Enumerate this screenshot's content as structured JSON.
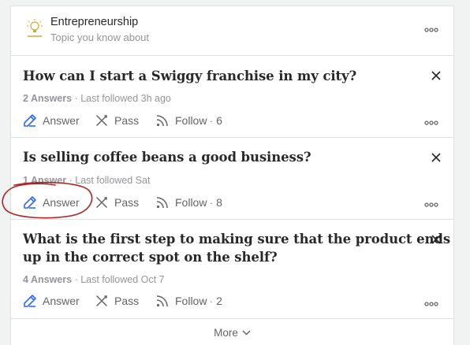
{
  "topic": {
    "title": "Entrepreneurship",
    "subtitle": "Topic you know about",
    "logo_icon": "lightbulb-logo"
  },
  "questions": [
    {
      "title": "How can I start a Swiggy franchise in my city?",
      "answers": "2 Answers",
      "last_followed": "Last followed 3h ago",
      "answer_label": "Answer",
      "pass_label": "Pass",
      "follow_label": "Follow",
      "follow_count": "6"
    },
    {
      "title": "Is selling coffee beans a good business?",
      "answers": "1 Answer",
      "last_followed": "Last followed Sat",
      "answer_label": "Answer",
      "pass_label": "Pass",
      "follow_label": "Follow",
      "follow_count": "8"
    },
    {
      "title_line1": "What is the first step to making sure that the product ends",
      "title_line2": "up in the correct spot on the shelf?",
      "answers": "4 Answers",
      "last_followed": "Last followed Oct 7",
      "answer_label": "Answer",
      "pass_label": "Pass",
      "follow_label": "Follow",
      "follow_count": "2"
    }
  ],
  "more_label": "More",
  "colors": {
    "answer_icon": "#2e69ff",
    "text_primary": "#282829",
    "text_secondary": "#636466",
    "text_muted": "#939598",
    "border": "#dee0e1",
    "annotation": "#b22222",
    "logo": "#d4a63a"
  }
}
